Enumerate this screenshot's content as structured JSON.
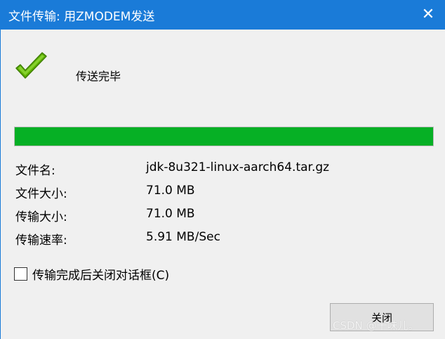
{
  "window": {
    "title": "文件传输: 用ZMODEM发送",
    "close_glyph": "✕"
  },
  "status": {
    "icon": "checkmark-icon",
    "text": "传送完毕"
  },
  "progress": {
    "percent": 100,
    "fill_color": "#06b025"
  },
  "info": {
    "filename_label": "文件名:",
    "filename_value": "jdk-8u321-linux-aarch64.tar.gz",
    "filesize_label": "文件大小:",
    "filesize_value": "71.0 MB",
    "transferred_label": "传输大小:",
    "transferred_value": "71.0 MB",
    "rate_label": "传输速率:",
    "rate_value": "5.91 MB/Sec"
  },
  "options": {
    "close_after_transfer_label": "传输完成后关闭对话框(C)",
    "close_after_transfer_checked": false
  },
  "buttons": {
    "close_label": "关闭"
  },
  "watermark": "CSDN @十味儿。"
}
